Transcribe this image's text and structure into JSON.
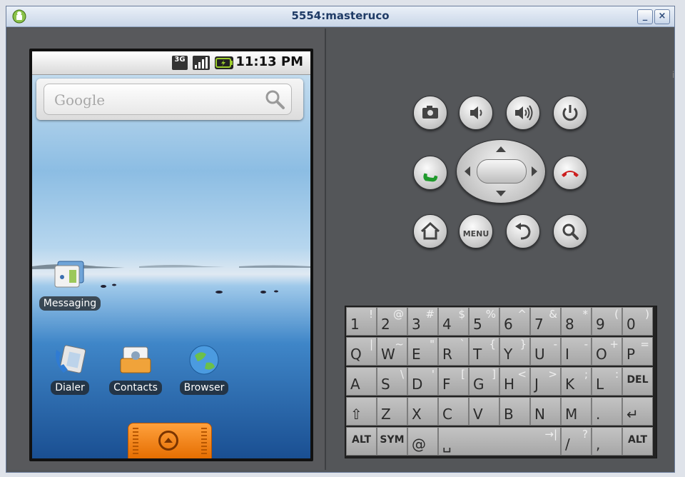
{
  "window": {
    "title": "5554:masteruco",
    "minimize_label": "_",
    "close_label": "×"
  },
  "statusbar": {
    "network": "3G",
    "time": "11:13 PM"
  },
  "search": {
    "placeholder": "Google"
  },
  "home_icons": [
    {
      "label": "Messaging"
    },
    {
      "label": "Dialer"
    },
    {
      "label": "Contacts"
    },
    {
      "label": "Browser"
    }
  ],
  "controls": {
    "menu_label": "MENU"
  },
  "keyboard": {
    "row1": [
      {
        "main": "1",
        "alt": "!"
      },
      {
        "main": "2",
        "alt": "@"
      },
      {
        "main": "3",
        "alt": "#"
      },
      {
        "main": "4",
        "alt": "$"
      },
      {
        "main": "5",
        "alt": "%"
      },
      {
        "main": "6",
        "alt": "^"
      },
      {
        "main": "7",
        "alt": "&"
      },
      {
        "main": "8",
        "alt": "*"
      },
      {
        "main": "9",
        "alt": "("
      },
      {
        "main": "0",
        "alt": ")"
      }
    ],
    "row2": [
      {
        "main": "Q",
        "alt": "|"
      },
      {
        "main": "W",
        "alt": "~"
      },
      {
        "main": "E",
        "alt": "\""
      },
      {
        "main": "R",
        "alt": "`"
      },
      {
        "main": "T",
        "alt": "{"
      },
      {
        "main": "Y",
        "alt": "}"
      },
      {
        "main": "U",
        "alt": "-"
      },
      {
        "main": "I",
        "alt": "-"
      },
      {
        "main": "O",
        "alt": "+"
      },
      {
        "main": "P",
        "alt": "="
      }
    ],
    "row3": [
      {
        "main": "A",
        "alt": ""
      },
      {
        "main": "S",
        "alt": "\\"
      },
      {
        "main": "D",
        "alt": "'"
      },
      {
        "main": "F",
        "alt": "["
      },
      {
        "main": "G",
        "alt": "]"
      },
      {
        "main": "H",
        "alt": "<"
      },
      {
        "main": "J",
        "alt": ">"
      },
      {
        "main": "K",
        "alt": ";"
      },
      {
        "main": "L",
        "alt": ":"
      },
      {
        "main": "DEL",
        "alt": ""
      }
    ],
    "row4": [
      {
        "main": "⇧",
        "alt": ""
      },
      {
        "main": "Z",
        "alt": ""
      },
      {
        "main": "X",
        "alt": ""
      },
      {
        "main": "C",
        "alt": ""
      },
      {
        "main": "V",
        "alt": ""
      },
      {
        "main": "B",
        "alt": ""
      },
      {
        "main": "N",
        "alt": ""
      },
      {
        "main": "M",
        "alt": ""
      },
      {
        "main": ".",
        "alt": ""
      },
      {
        "main": "↵",
        "alt": ""
      }
    ],
    "row5": [
      {
        "main": "ALT",
        "alt": ""
      },
      {
        "main": "SYM",
        "alt": ""
      },
      {
        "main": "@",
        "alt": ""
      },
      {
        "main": "␣",
        "alt": "→|"
      },
      {
        "main": "/",
        "alt": "?"
      },
      {
        "main": ",",
        "alt": ""
      },
      {
        "main": "ALT",
        "alt": ""
      }
    ]
  }
}
